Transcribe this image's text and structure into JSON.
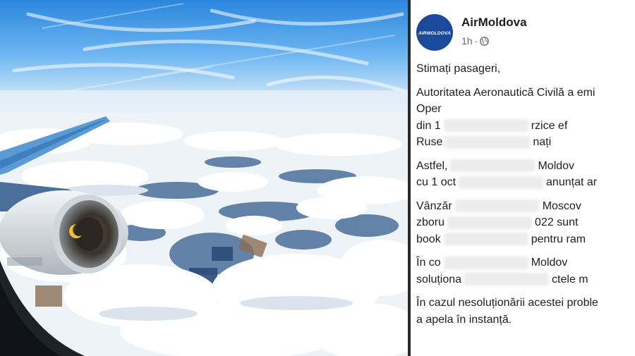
{
  "post": {
    "page_name": "AirMoldova",
    "avatar_text": "AIRMOLDOVA",
    "time": "1h",
    "separator": "·",
    "globe_icon": "globe-icon",
    "paragraphs": [
      {
        "lines": [
          {
            "text": "Stimați pasageri,"
          }
        ]
      },
      {
        "lines": [
          {
            "text": "Autoritatea Aeronautică Civilă a emi",
            "blurred_part": ""
          },
          {
            "text": "Oper",
            "blurred_part": ""
          },
          {
            "text": "din 1",
            "tail": "rzice ef"
          },
          {
            "text": "Ruse",
            "tail": "nați"
          }
        ]
      },
      {
        "lines": [
          {
            "text": "Astfel,",
            "tail": "Moldov"
          },
          {
            "text": "cu 1 oct",
            "tail": "anunțat ar"
          }
        ]
      },
      {
        "lines": [
          {
            "text": "Vânzăr",
            "tail": "Moscov"
          },
          {
            "text": "zboru",
            "tail": "022 sunt"
          },
          {
            "text": "book",
            "tail": "pentru ram"
          }
        ]
      },
      {
        "lines": [
          {
            "text": "În co",
            "tail": "Moldov"
          },
          {
            "text": "soluționa",
            "tail": "ctele m"
          }
        ]
      },
      {
        "lines": [
          {
            "text": "În cazul nesoluționării acestei proble"
          },
          {
            "text": "a apela în instanță."
          }
        ]
      }
    ]
  },
  "photo": {
    "engine_logo": "moon-icon"
  }
}
